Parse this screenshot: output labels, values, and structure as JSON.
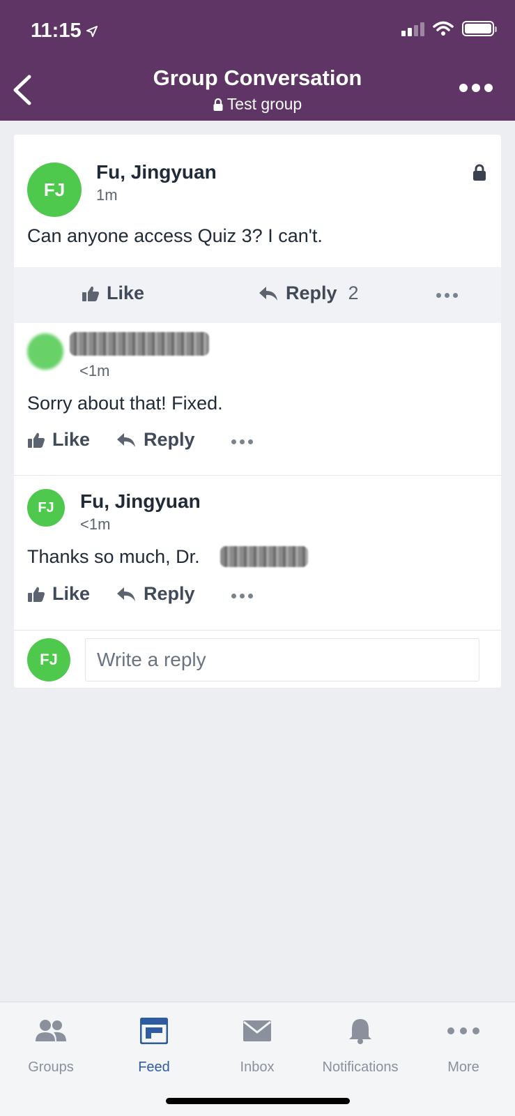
{
  "status": {
    "time": "11:15"
  },
  "header": {
    "title": "Group Conversation",
    "subtitle": "Test group"
  },
  "post": {
    "avatar": "FJ",
    "author": "Fu, Jingyuan",
    "time": "1m",
    "body": "Can anyone access Quiz 3? I can't.",
    "like_label": "Like",
    "reply_label": "Reply",
    "reply_count": "2"
  },
  "replies": [
    {
      "author": "",
      "time": "<1m",
      "body": "Sorry about that! Fixed.",
      "like_label": "Like",
      "reply_label": "Reply"
    },
    {
      "avatar": "FJ",
      "author": "Fu, Jingyuan",
      "time": "<1m",
      "body": "Thanks so much, Dr.",
      "like_label": "Like",
      "reply_label": "Reply"
    }
  ],
  "composer": {
    "avatar": "FJ",
    "placeholder": "Write a reply"
  },
  "nav": [
    {
      "label": "Groups",
      "icon": "groups-icon"
    },
    {
      "label": "Feed",
      "icon": "feed-icon",
      "active": true
    },
    {
      "label": "Inbox",
      "icon": "inbox-icon"
    },
    {
      "label": "Notifications",
      "icon": "bell-icon"
    },
    {
      "label": "More",
      "icon": "more-icon"
    }
  ],
  "colors": {
    "header": "#5e3565",
    "avatar": "#4ec94e",
    "active_nav": "#2f5ba3"
  }
}
